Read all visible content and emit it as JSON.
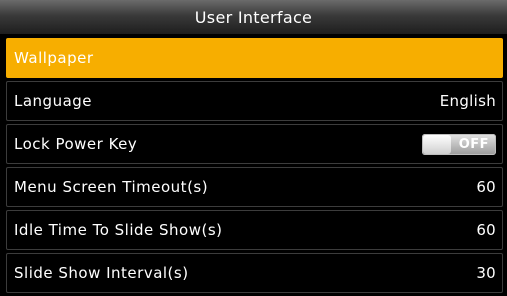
{
  "header": {
    "title": "User Interface"
  },
  "menu": {
    "items": [
      {
        "label": "Wallpaper",
        "value": ""
      },
      {
        "label": "Language",
        "value": "English"
      },
      {
        "label": "Lock Power Key",
        "toggle": "OFF"
      },
      {
        "label": "Menu Screen Timeout(s)",
        "value": "60"
      },
      {
        "label": "Idle Time To Slide Show(s)",
        "value": "60"
      },
      {
        "label": "Slide Show Interval(s)",
        "value": "30"
      }
    ]
  },
  "colors": {
    "background": "#000000",
    "selected": "#f7ae00",
    "text": "#ffffff",
    "row_border": "#3c3c3c"
  }
}
